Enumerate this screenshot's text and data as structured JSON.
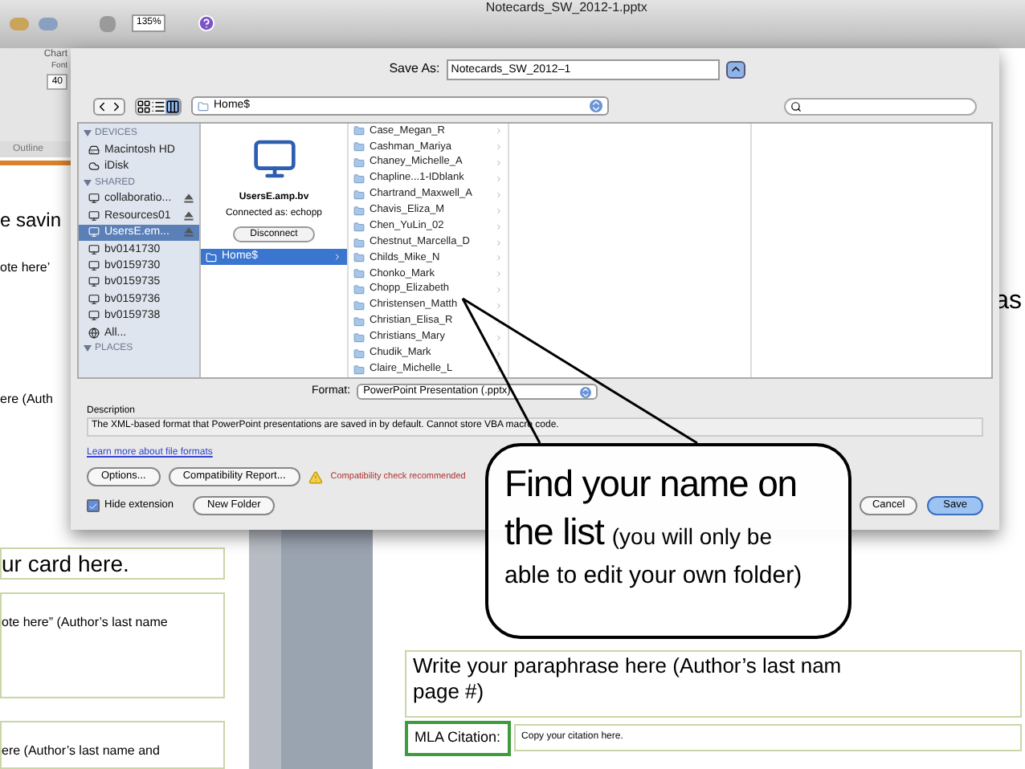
{
  "app": {
    "title": "Notecards_SW_2012-1.pptx",
    "zoom": "135%",
    "ribbon_tab": "Chart",
    "group_label": "Font",
    "font_size": "40",
    "pane_tab": "Outline"
  },
  "slide_pane": {
    "snippets": [
      "e savin",
      "ote here’",
      "ere (Auth",
      "ur card here.",
      "ote here” (Author’s last name",
      "ere (Author’s last name and"
    ]
  },
  "slide": {
    "title_fragment": "as",
    "paraphrase": "Write your paraphrase here (Author’s last nam",
    "paraphrase_2": "page #)",
    "citation_label": "MLA Citation:",
    "citation_value": "Copy your citation here."
  },
  "save_dialog": {
    "save_as_label": "Save As:",
    "file_name": "Notecards_SW_2012–1",
    "path": "Home$",
    "sidebar": [
      {
        "heading": "DEVICES",
        "items": [
          {
            "label": "Macintosh HD",
            "selected": false,
            "ejectable": false
          },
          {
            "label": "iDisk",
            "selected": false,
            "ejectable": false
          }
        ]
      },
      {
        "heading": "SHARED",
        "items": [
          {
            "label": "collaboratio...",
            "selected": false,
            "ejectable": true
          },
          {
            "label": "Resources01",
            "selected": false,
            "ejectable": true
          },
          {
            "label": "UsersE.em...",
            "selected": true,
            "ejectable": true
          },
          {
            "label": "bv0141730",
            "selected": false,
            "ejectable": false
          },
          {
            "label": "bv0159730",
            "selected": false,
            "ejectable": false
          },
          {
            "label": "bv0159735",
            "selected": false,
            "ejectable": false
          },
          {
            "label": "bv0159736",
            "selected": false,
            "ejectable": false
          },
          {
            "label": "bv0159738",
            "selected": false,
            "ejectable": false
          },
          {
            "label": "All...",
            "selected": false,
            "ejectable": false
          }
        ]
      },
      {
        "heading": "PLACES"
      }
    ],
    "server": {
      "name": "UsersE.amp.bv",
      "connected_as": "Connected as: echopp",
      "disconnect": "Disconnect",
      "shares": [
        {
          "label": "Home$",
          "selected": true
        }
      ]
    },
    "folders": [
      {
        "label": "Case_Megan_R",
        "selected": false
      },
      {
        "label": "Cashman_Mariya",
        "selected": false
      },
      {
        "label": "Chaney_Michelle_A",
        "selected": false
      },
      {
        "label": "Chapline...1-IDblank",
        "selected": false
      },
      {
        "label": "Chartrand_Maxwell_A",
        "selected": false
      },
      {
        "label": "Chavis_Eliza_M",
        "selected": false
      },
      {
        "label": "Chen_YuLin_02",
        "selected": false
      },
      {
        "label": "Chestnut_Marcella_D",
        "selected": false
      },
      {
        "label": "Childs_Mike_N",
        "selected": false
      },
      {
        "label": "Chonko_Mark",
        "selected": false
      },
      {
        "label": "Chopp_Elizabeth",
        "selected": false
      },
      {
        "label": "Christensen_Matth",
        "selected": false
      },
      {
        "label": "Christian_Elisa_R",
        "selected": false
      },
      {
        "label": "Christians_Mary",
        "selected": false
      },
      {
        "label": "Chudik_Mark",
        "selected": false
      },
      {
        "label": "Claire_Michelle_L",
        "selected": false
      }
    ],
    "format_label": "Format:",
    "format": "PowerPoint Presentation (.pptx)",
    "description_label": "Description",
    "description": "The XML-based format that PowerPoint presentations are saved in by default. Cannot store VBA macro code.",
    "learn_more": "Learn more about file formats",
    "options": "Options...",
    "compat_report": "Compatibility Report...",
    "warning": "Compatibility check recommended",
    "hide_extension": {
      "label": "Hide extension",
      "checked": true
    },
    "new_folder": "New Folder",
    "cancel": "Cancel",
    "save": "Save"
  },
  "callout": {
    "headline": "Find your name on",
    "line2_big": "the list",
    "line2_small": "(you will only be",
    "line3": "able to edit your own folder)"
  }
}
